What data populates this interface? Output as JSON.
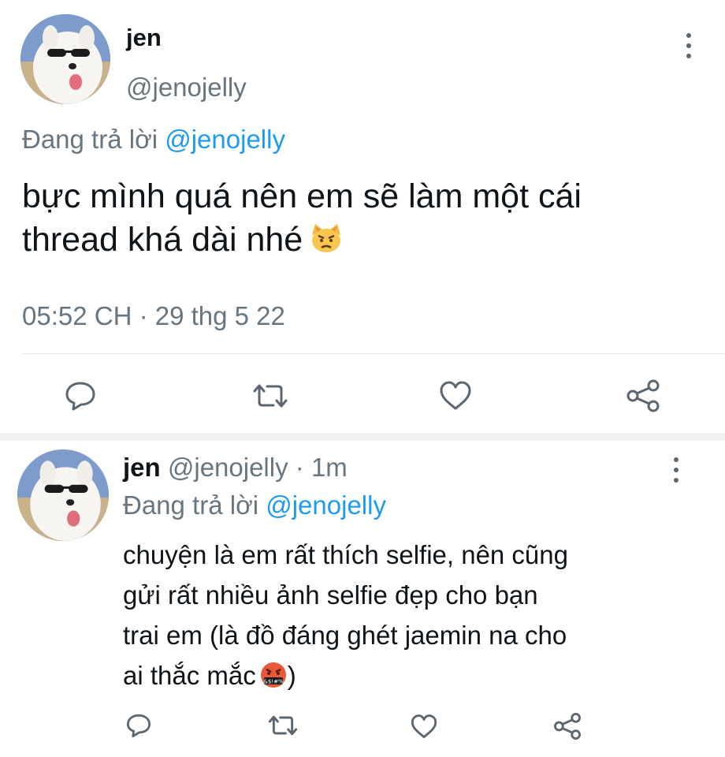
{
  "main_tweet": {
    "author_name": "jen",
    "author_handle": "@jenojelly",
    "replying_prefix": "Đang trả lời",
    "replying_to": "@jenojelly",
    "text_line1": "bực mình quá nên em sẽ làm một cái",
    "text_line2": "thread khá dài nhé",
    "emoji": "cat-angry-emoji",
    "timestamp": "05:52 CH · 29 thg 5 22",
    "actions": [
      "reply-icon",
      "retweet-icon",
      "like-icon",
      "share-icon"
    ]
  },
  "reply_tweet": {
    "author_name": "jen",
    "author_handle": "@jenojelly",
    "time_sep": "·",
    "time_ago": "1m",
    "replying_prefix": "Đang trả lời",
    "replying_to": "@jenojelly",
    "lines": [
      "chuyện là em rất thích selfie, nên cũng",
      "gửi rất nhiều ảnh selfie đẹp cho bạn",
      "trai em (là đồ đáng ghét jaemin na cho",
      "ai thắc mắc"
    ],
    "closing": ")",
    "emoji": "cursing-face-emoji",
    "actions": [
      "reply-icon",
      "retweet-icon",
      "like-icon",
      "share-icon"
    ]
  },
  "colors": {
    "link_blue": "#1d9bf0",
    "secondary_grey": "#66757f",
    "text": "#0f1419"
  }
}
